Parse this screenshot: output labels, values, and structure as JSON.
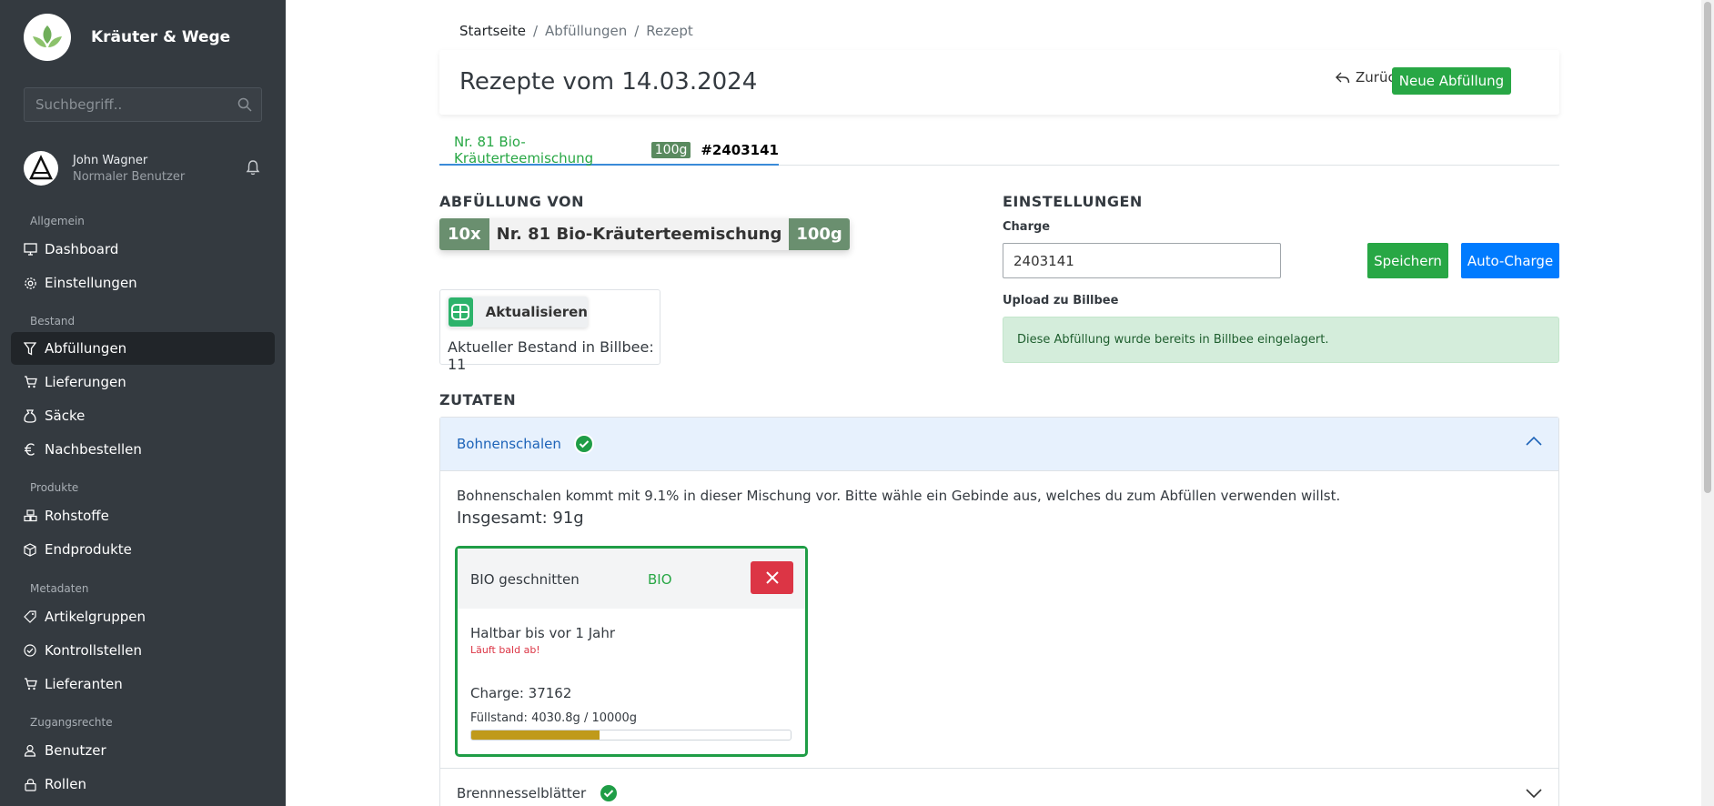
{
  "brand": {
    "name": "Kräuter & Wege"
  },
  "search": {
    "placeholder": "Suchbegriff.."
  },
  "user": {
    "name": "John Wagner",
    "role": "Normaler Benutzer"
  },
  "nav": {
    "sections": [
      {
        "label": "Allgemein",
        "items": [
          {
            "label": "Dashboard",
            "icon": "monitor-icon"
          },
          {
            "label": "Einstellungen",
            "icon": "gear-icon"
          }
        ]
      },
      {
        "label": "Bestand",
        "items": [
          {
            "label": "Abfüllungen",
            "icon": "funnel-icon",
            "active": true
          },
          {
            "label": "Lieferungen",
            "icon": "cart-icon"
          },
          {
            "label": "Säcke",
            "icon": "sack-icon"
          },
          {
            "label": "Nachbestellen",
            "icon": "euro-icon"
          }
        ]
      },
      {
        "label": "Produkte",
        "items": [
          {
            "label": "Rohstoffe",
            "icon": "boxes-icon"
          },
          {
            "label": "Endprodukte",
            "icon": "box-icon"
          }
        ]
      },
      {
        "label": "Metadaten",
        "items": [
          {
            "label": "Artikelgruppen",
            "icon": "tag-icon"
          },
          {
            "label": "Kontrollstellen",
            "icon": "check-circle-icon"
          },
          {
            "label": "Lieferanten",
            "icon": "cart-icon"
          }
        ]
      },
      {
        "label": "Zugangsrechte",
        "items": [
          {
            "label": "Benutzer",
            "icon": "user-icon"
          },
          {
            "label": "Rollen",
            "icon": "lock-icon"
          }
        ]
      }
    ]
  },
  "breadcrumb": [
    "Startseite",
    "Abfüllungen",
    "Rezept"
  ],
  "header": {
    "title": "Rezepte vom 14.03.2024",
    "back_label": "Zurück",
    "new_label": "Neue Abfüllung"
  },
  "tab": {
    "name": "Nr. 81 Bio-Kräuterteemischung",
    "qty": "100g",
    "number": "#2403141"
  },
  "filling": {
    "title": "ABFÜLLUNG VON",
    "count": "10x",
    "product": "Nr. 81 Bio-Kräuterteemischung",
    "qty": "100g",
    "update_label": "Aktualisieren",
    "stock_text": "Aktueller Bestand in Billbee: 11"
  },
  "settings": {
    "title": "EINSTELLUNGEN",
    "charge_label": "Charge",
    "charge_value": "2403141",
    "save_label": "Speichern",
    "auto_label": "Auto-Charge",
    "upload_label": "Upload zu Billbee",
    "alert_text": "Diese Abfüllung wurde bereits in Billbee eingelagert."
  },
  "ingredients": {
    "title": "ZUTATEN",
    "items": [
      {
        "name": "Bohnenschalen",
        "desc": "Bohnenschalen kommt mit 9.1% in dieser Mischung vor. Bitte wähle ein Gebinde aus, welches du zum Abfüllen verwenden willst.",
        "total": "Insgesamt: 91g",
        "lot": {
          "title": "BIO geschnitten",
          "bio": "BIO",
          "expiry": "Haltbar bis vor 1 Jahr",
          "warning": "Läuft bald ab!",
          "charge": "Charge: 37162",
          "fill": "Füllstand: 4030.8g / 10000g",
          "fill_fraction": 0.4031
        }
      },
      {
        "name": "Brennnesselblätter"
      }
    ]
  },
  "colors": {
    "sidebar": "#343a40",
    "primary_green": "#28a745",
    "primary_blue": "#007bff",
    "danger": "#dc3545",
    "progress": "#c09a1a"
  }
}
